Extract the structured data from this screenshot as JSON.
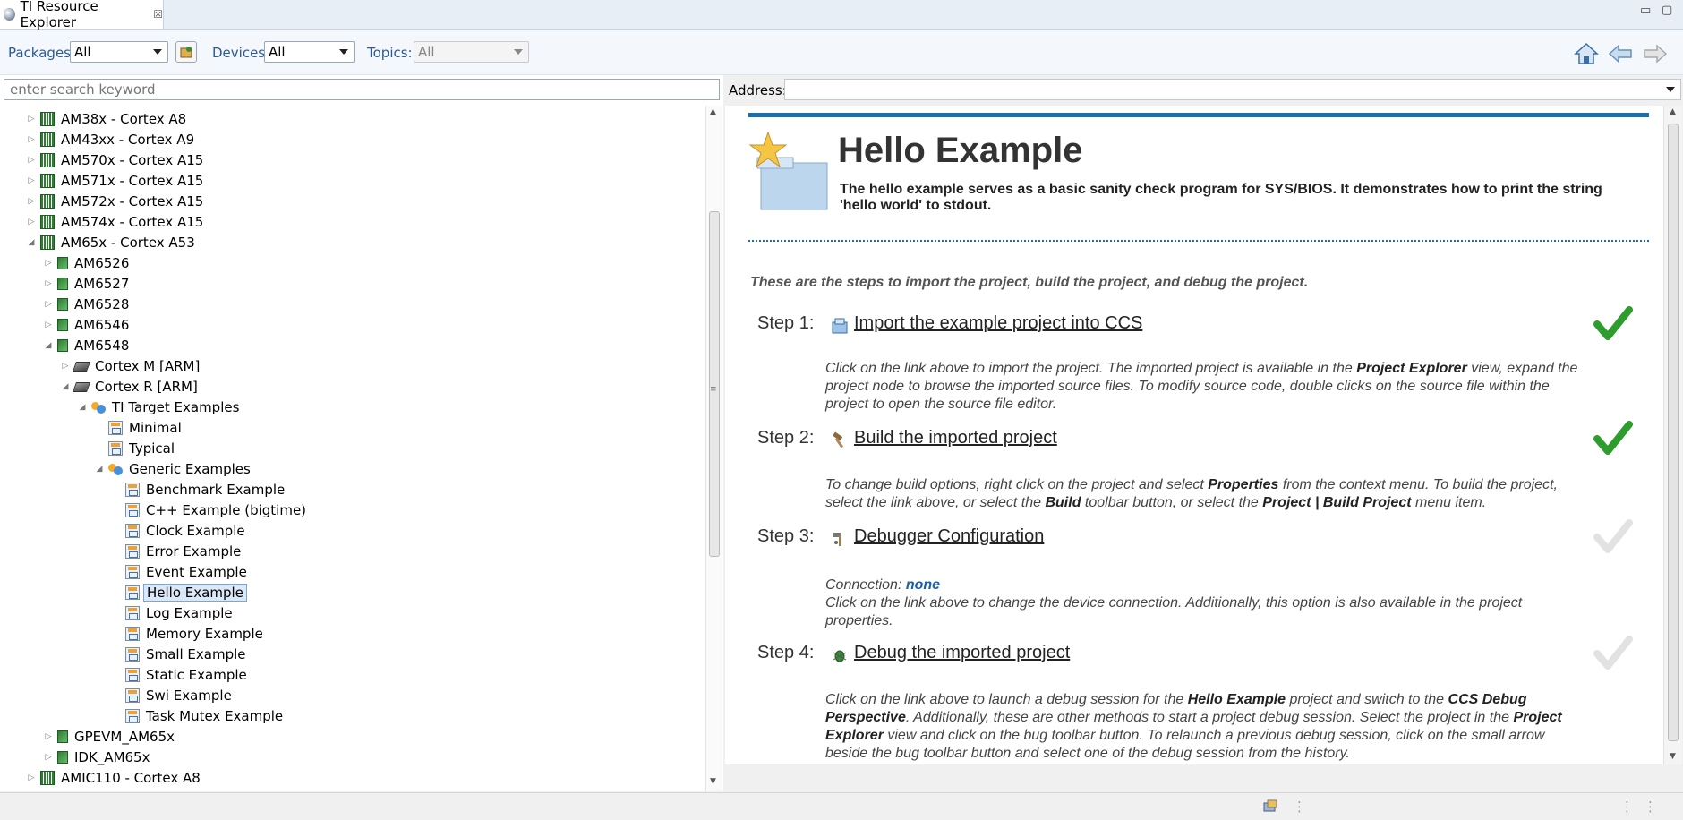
{
  "window": {
    "tab_title": "TI Resource Explorer",
    "tab_close": "☒",
    "minimize": "▭",
    "maximize": "▢"
  },
  "toolbar": {
    "packages_label": "Packages:",
    "packages_value": "All",
    "devices_label": "Devices:",
    "devices_value": "All",
    "topics_label": "Topics:",
    "topics_value": "All",
    "icons": [
      "home-icon",
      "back-arrow-icon",
      "forward-arrow-icon"
    ]
  },
  "search": {
    "placeholder": "enter search keyword"
  },
  "tree": {
    "rows": [
      {
        "label": "AM38x - Cortex A8",
        "icon": "chip",
        "toggle": "▷"
      },
      {
        "label": "AM43xx - Cortex A9",
        "icon": "chip",
        "toggle": "▷"
      },
      {
        "label": "AM570x - Cortex A15",
        "icon": "chip",
        "toggle": "▷"
      },
      {
        "label": "AM571x - Cortex A15",
        "icon": "chip",
        "toggle": "▷"
      },
      {
        "label": "AM572x - Cortex A15",
        "icon": "chip",
        "toggle": "▷"
      },
      {
        "label": "AM574x - Cortex A15",
        "icon": "chip",
        "toggle": "▷"
      },
      {
        "label": "AM65x - Cortex A53",
        "icon": "chip",
        "toggle": "◢"
      },
      {
        "label": "AM6526",
        "icon": "chip2",
        "toggle": "▷"
      },
      {
        "label": "AM6527",
        "icon": "chip2",
        "toggle": "▷"
      },
      {
        "label": "AM6528",
        "icon": "chip2",
        "toggle": "▷"
      },
      {
        "label": "AM6546",
        "icon": "chip2",
        "toggle": "▷"
      },
      {
        "label": "AM6548",
        "icon": "chip2",
        "toggle": "◢"
      },
      {
        "label": "Cortex M [ARM]",
        "icon": "cpu",
        "toggle": "▷"
      },
      {
        "label": "Cortex R [ARM]",
        "icon": "cpu",
        "toggle": "◢"
      },
      {
        "label": "TI Target Examples",
        "icon": "grp",
        "toggle": "◢"
      },
      {
        "label": "Minimal",
        "icon": "ex",
        "toggle": ""
      },
      {
        "label": "Typical",
        "icon": "ex",
        "toggle": ""
      },
      {
        "label": "Generic Examples",
        "icon": "grp",
        "toggle": "◢"
      },
      {
        "label": "Benchmark Example",
        "icon": "ex",
        "toggle": ""
      },
      {
        "label": "C++ Example (bigtime)",
        "icon": "ex",
        "toggle": ""
      },
      {
        "label": "Clock Example",
        "icon": "ex",
        "toggle": ""
      },
      {
        "label": "Error Example",
        "icon": "ex",
        "toggle": ""
      },
      {
        "label": "Event Example",
        "icon": "ex",
        "toggle": ""
      },
      {
        "label": "Hello Example",
        "icon": "ex",
        "toggle": "",
        "selected": true
      },
      {
        "label": "Log Example",
        "icon": "ex",
        "toggle": ""
      },
      {
        "label": "Memory Example",
        "icon": "ex",
        "toggle": ""
      },
      {
        "label": "Small Example",
        "icon": "ex",
        "toggle": ""
      },
      {
        "label": "Static Example",
        "icon": "ex",
        "toggle": ""
      },
      {
        "label": "Swi Example",
        "icon": "ex",
        "toggle": ""
      },
      {
        "label": "Task Mutex Example",
        "icon": "ex",
        "toggle": ""
      },
      {
        "label": "GPEVM_AM65x",
        "icon": "chip2",
        "toggle": "▷"
      },
      {
        "label": "IDK_AM65x",
        "icon": "chip2",
        "toggle": "▷"
      },
      {
        "label": "AMIC110 - Cortex A8",
        "icon": "chip",
        "toggle": "▷"
      }
    ]
  },
  "address": {
    "label": "Address:",
    "value": ""
  },
  "page": {
    "title": "Hello Example",
    "description": "The hello example serves as a basic sanity check program for SYS/BIOS. It demonstrates how to print the string 'hello world' to stdout.",
    "intro": "These are the steps to import the project, build the project, and debug the project.",
    "steps": [
      {
        "label": "Step 1:",
        "link": "Import the example project into CCS",
        "icon": "import-icon",
        "done": true,
        "body": "Click on the link above to import the project. The imported project is available in the <b>Project Explorer</b> view, expand the project node to browse the imported source files. To modify source code, double clicks on the source file within the project to open the source file editor."
      },
      {
        "label": "Step 2:",
        "link": "Build the imported project",
        "icon": "hammer-icon",
        "done": true,
        "body": "To change build options, right click on the project and select <b>Properties</b> from the context menu. To build the project, select the link above, or select the <b>Build</b> toolbar button, or select the <b>Project | Build Project</b> menu item."
      },
      {
        "label": "Step 3:",
        "link": "Debugger Configuration",
        "icon": "debugger-config-icon",
        "done": false,
        "body": "Connection: <span class=\"conn\">none</span><br>Click on the link above to change the device connection. Additionally, this option is also available in the project properties."
      },
      {
        "label": "Step 4:",
        "link": "Debug the imported project",
        "icon": "bug-icon",
        "done": false,
        "body": "Click on the link above to launch a debug session for the <b>Hello Example</b> project and switch to the <b>CCS Debug Perspective</b>. Additionally, these are other methods to start a project debug session. Select the project in the <b>Project Explorer</b> view and click on the bug toolbar button. To relaunch a previous debug session, click on the small arrow beside the bug toolbar button and select one of the debug session from the history."
      }
    ]
  },
  "colors": {
    "accent": "#1a6fa8",
    "check_done": "#2e9d2e",
    "check_pending": "#e2e2e2"
  }
}
